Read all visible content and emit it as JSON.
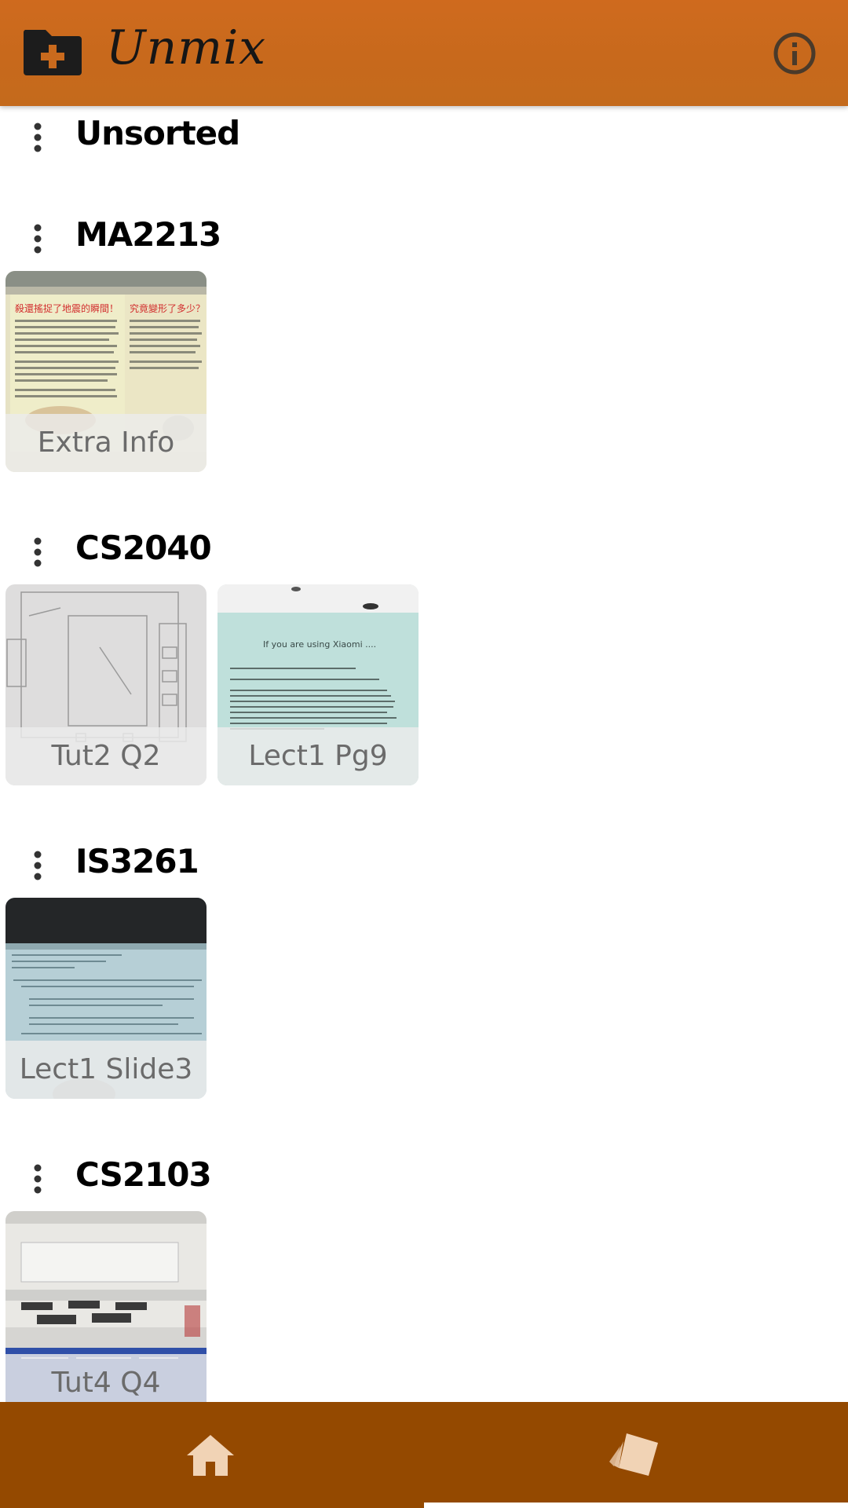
{
  "header": {
    "title": "Unmix",
    "add_icon": "folder-plus-icon",
    "info_icon": "info-circle-icon"
  },
  "sections": [
    {
      "title": "Unsorted",
      "cards": []
    },
    {
      "title": "MA2213",
      "cards": [
        {
          "label": "Extra Info"
        }
      ]
    },
    {
      "title": "CS2040",
      "cards": [
        {
          "label": "Tut2 Q2"
        },
        {
          "label": "Lect1 Pg9"
        }
      ]
    },
    {
      "title": "IS3261",
      "cards": [
        {
          "label": "Lect1 Slide3"
        }
      ]
    },
    {
      "title": "CS2103",
      "cards": [
        {
          "label": "Tut4 Q4"
        }
      ]
    }
  ],
  "thumb_text": {
    "lect1_pg9_heading": "If you are using Xiaomi ....",
    "ma2213_heading_left": "殺還搖捉了地震的瞬間！",
    "ma2213_heading_right": "究竟變形了多少？"
  },
  "bottom_nav": {
    "items": [
      {
        "icon": "home-icon",
        "active": false
      },
      {
        "icon": "cards-icon",
        "active": true
      }
    ]
  },
  "colors": {
    "header": "#c96a1d",
    "bottom_nav": "#944900",
    "label_text": "#6b6b6b"
  }
}
